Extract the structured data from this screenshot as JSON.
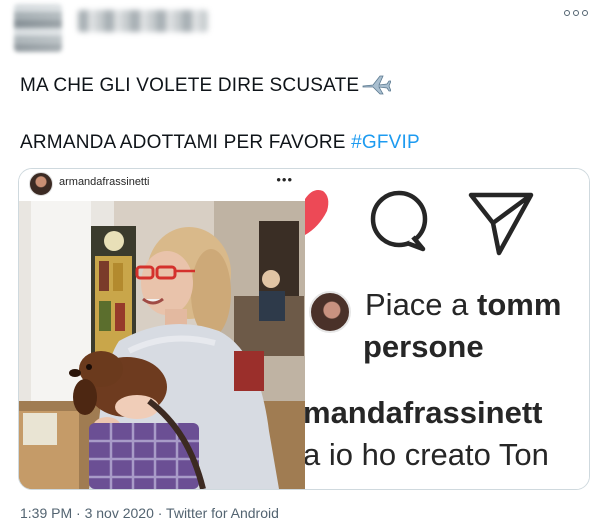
{
  "tweet": {
    "line1": "MA CHE GLI VOLETE DIRE SCUSATE",
    "line2_text": "ARMANDA ADOTTAMI PER FAVORE ",
    "hashtag": "#GFVIP",
    "plane_icon": "airplane-emoji",
    "more_icon": "more-dots-icon"
  },
  "media": {
    "left": {
      "username": "armandafrassinetti",
      "more": "•••"
    },
    "right": {
      "likes_prefix": "Piace a ",
      "likes_user": "tomm",
      "likes_people": "persone",
      "caption_user": "mandafrassinett",
      "caption_text": "a io ho creato Ton",
      "icons": [
        "heart-icon",
        "comment-icon",
        "share-icon"
      ]
    }
  },
  "footer": {
    "text": "1:39 PM · 3 nov 2020 · Twitter for Android"
  },
  "colors": {
    "hashtag": "#1d9bf0",
    "text": "#0f1419",
    "muted": "#536471",
    "heart": "#ed4956"
  }
}
